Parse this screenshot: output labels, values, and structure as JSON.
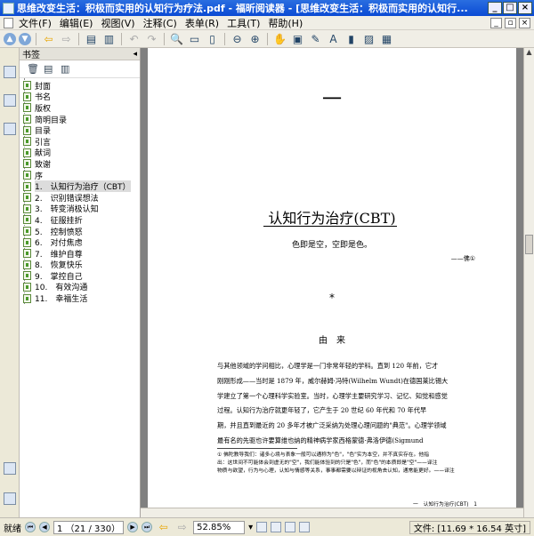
{
  "window": {
    "title": "思维改变生活：积极而实用的认知行为疗法.pdf - 福昕阅读器 - [思维改变生活：积极而实用的认知行...",
    "controls": [
      "_",
      "□",
      "×"
    ]
  },
  "menu": {
    "items": [
      "文件(F)",
      "编辑(E)",
      "视图(V)",
      "注释(C)",
      "表单(R)",
      "工具(T)",
      "帮助(H)"
    ]
  },
  "panel": {
    "title": "书签",
    "pin": "◂"
  },
  "bookmarks": [
    {
      "label": "封面"
    },
    {
      "label": "书名"
    },
    {
      "label": "版权"
    },
    {
      "label": "简明目录"
    },
    {
      "label": "目录"
    },
    {
      "label": "引言"
    },
    {
      "label": "献词"
    },
    {
      "label": "致谢"
    },
    {
      "label": "序"
    },
    {
      "label": "1.　认知行为治疗（CBT）"
    },
    {
      "label": "2.　识别错误想法"
    },
    {
      "label": "3.　转变消极认知"
    },
    {
      "label": "4.　征服挂折"
    },
    {
      "label": "5.　控制愤怒"
    },
    {
      "label": "6.　对付焦虑"
    },
    {
      "label": "7.　维护自尊"
    },
    {
      "label": "8.　恢复快乐"
    },
    {
      "label": "9.　掌控自己"
    },
    {
      "label": "10.　有效沟通"
    },
    {
      "label": "11.　幸福生活"
    }
  ],
  "selected_bookmark_index": 9,
  "page": {
    "chapter_number": "一",
    "title": "认知行为治疗(CBT)",
    "epigraph": "色即是空，空即是色。",
    "attribution": "——佛①",
    "ornament": "*",
    "section_title": "由　来",
    "body_lines": [
      "与其他领域的学问相比，心理学是一门非常年轻的学科。直到 120 年前，它才",
      "刚刚形成——当时是 1879 年，威尔赫姆·冯特(Wilhelm Wundt)在德国莱比锡大",
      "学建立了第一个心理科学实验室。当时，心理学主要研究学习、记忆、知觉和感觉",
      "过程。认知行为治疗就更年轻了，它产生于 20 世纪 60 年代和 70 年代早",
      "期，并且直到最近的 20 多年才被广泛采纳为处理心理问题的\"典范\"。心理学领域",
      "最有名的先驱也许要算维也纳的精神病学家西格蒙德·弗洛伊德(Sigmund"
    ],
    "footnote_lines": [
      "① 佛陀教导我们：诸多心境与表象一般可以通称为\"色\"，\"色\"实为本空，并不真实存在。他指",
      "出：这世间不可能体会到虚无的\"空\"，我们能体验到的只是\"色\"，而\"色\"的本质即是\"空\"——译注",
      "物质与欲望，行为与心理，认知与情感等关系，事事都需要以辩证的视角去认知，通常能更好。——译注"
    ],
    "running_footer": "一　认知行为治疗(CBT)　1"
  },
  "status": {
    "ready_label": "就绪",
    "page_label": "1 （21 / 330）",
    "zoom": "52.85%",
    "file_info": "文件: [11.69 * 16.54 英寸]"
  }
}
